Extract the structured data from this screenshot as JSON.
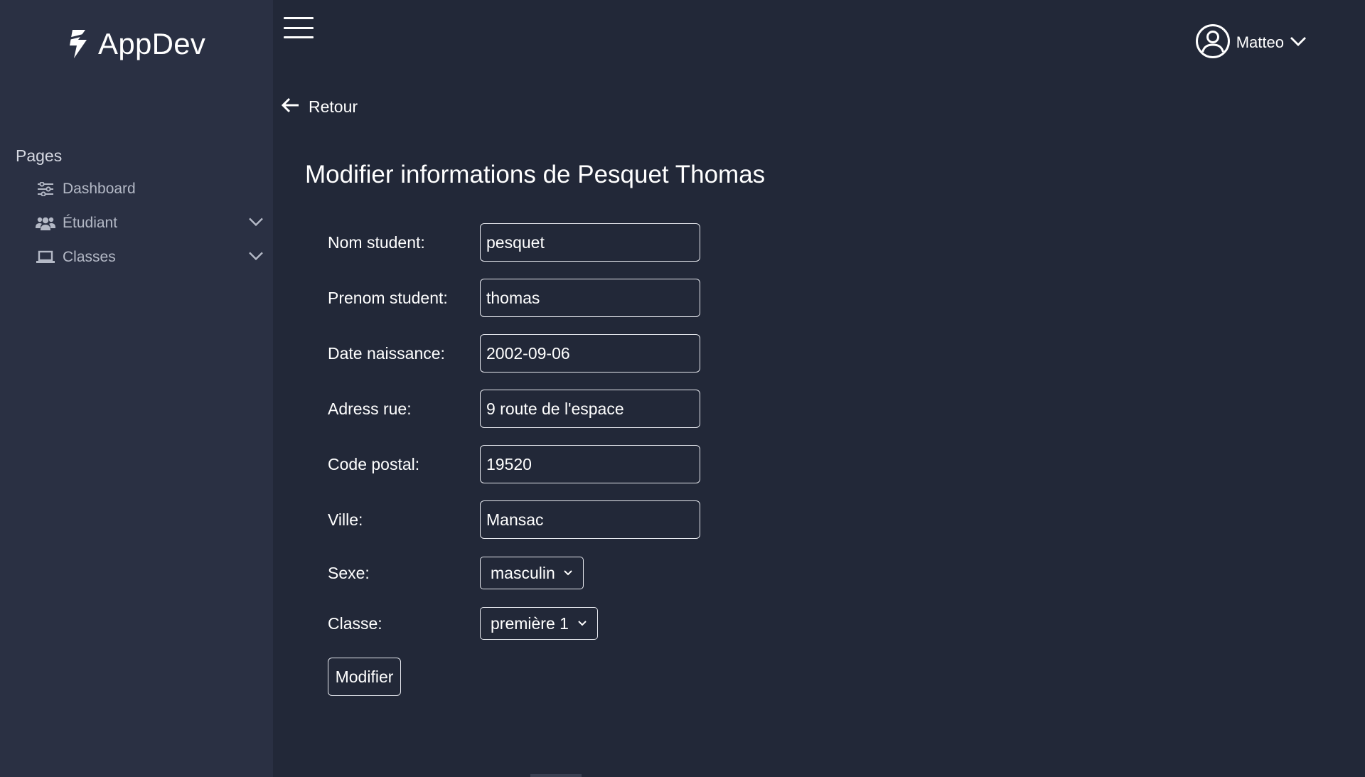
{
  "brand": {
    "name": "AppDev",
    "icon": "lightning-logo-icon"
  },
  "sidebar": {
    "section_title": "Pages",
    "items": [
      {
        "label": "Dashboard",
        "icon": "sliders-icon",
        "has_submenu": false
      },
      {
        "label": "Étudiant",
        "icon": "users-icon",
        "has_submenu": true
      },
      {
        "label": "Classes",
        "icon": "laptop-icon",
        "has_submenu": true
      }
    ]
  },
  "topbar": {
    "menu_icon": "hamburger-icon",
    "user": {
      "name": "Matteo",
      "icon": "user-circle-icon"
    }
  },
  "main": {
    "back_label": "Retour",
    "title": "Modifier informations de Pesquet Thomas",
    "form": {
      "nom": {
        "label": "Nom student:",
        "value": "pesquet"
      },
      "prenom": {
        "label": "Prenom student:",
        "value": "thomas"
      },
      "date": {
        "label": "Date naissance:",
        "value": "2002-09-06"
      },
      "adresse": {
        "label": "Adress rue:",
        "value": "9 route de l'espace"
      },
      "code_postal": {
        "label": "Code postal:",
        "value": "19520"
      },
      "ville": {
        "label": "Ville:",
        "value": "Mansac"
      },
      "sexe": {
        "label": "Sexe:",
        "selected": "masculin"
      },
      "classe": {
        "label": "Classe:",
        "selected": "première 1"
      },
      "submit_label": "Modifier"
    }
  },
  "colors": {
    "background": "#222838",
    "sidebar": "#2a3043",
    "nav_text": "#b4b9c6",
    "text": "#ffffff",
    "border": "#e6e8ee"
  }
}
